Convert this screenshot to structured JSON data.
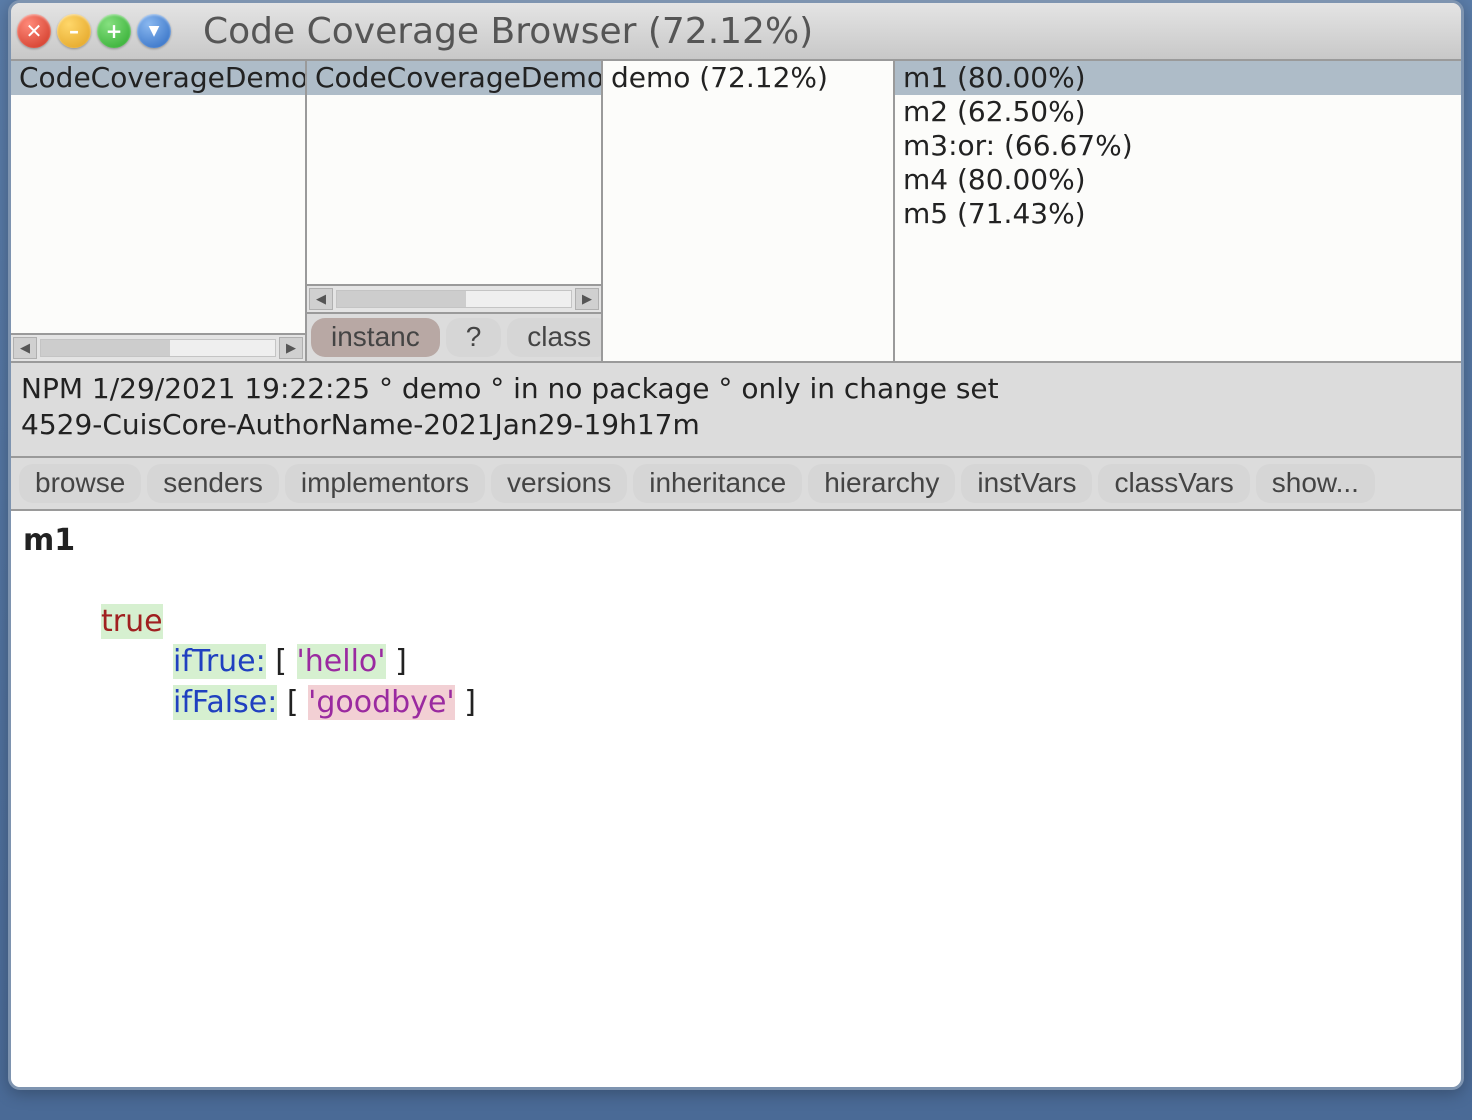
{
  "title": "Code Coverage Browser (72.12%)",
  "panes": {
    "pane1": {
      "items": [
        "CodeCoverageDemo"
      ],
      "selected": 0
    },
    "pane2": {
      "items": [
        "CodeCoverageDemo"
      ],
      "selected": 0
    },
    "pane3": {
      "items": [
        "demo (72.12%)"
      ],
      "selected": 0
    },
    "pane4": {
      "items": [
        "m1 (80.00%)",
        "m2 (62.50%)",
        "m3:or: (66.67%)",
        "m4 (80.00%)",
        "m5 (71.43%)"
      ],
      "selected": 0
    }
  },
  "classButtons": {
    "instance": "instanc",
    "query": "?",
    "class_": "class"
  },
  "info_line1": "NPM 1/29/2021 19:22:25 ° demo ° in no package ° only in change set",
  "info_line2": "4529-CuisCore-AuthorName-2021Jan29-19h17m",
  "toolbar": {
    "browse": "browse",
    "senders": "senders",
    "implementors": "implementors",
    "versions": "versions",
    "inheritance": "inheritance",
    "hierarchy": "hierarchy",
    "instVars": "instVars",
    "classVars": "classVars",
    "show": "show..."
  },
  "code": {
    "selector": "m1",
    "true_kw": "true",
    "ifTrue": "ifTrue:",
    "ifFalse": "ifFalse:",
    "hello": "'hello'",
    "goodbye": "'goodbye'",
    "lb": "[ ",
    "rb": " ]"
  }
}
